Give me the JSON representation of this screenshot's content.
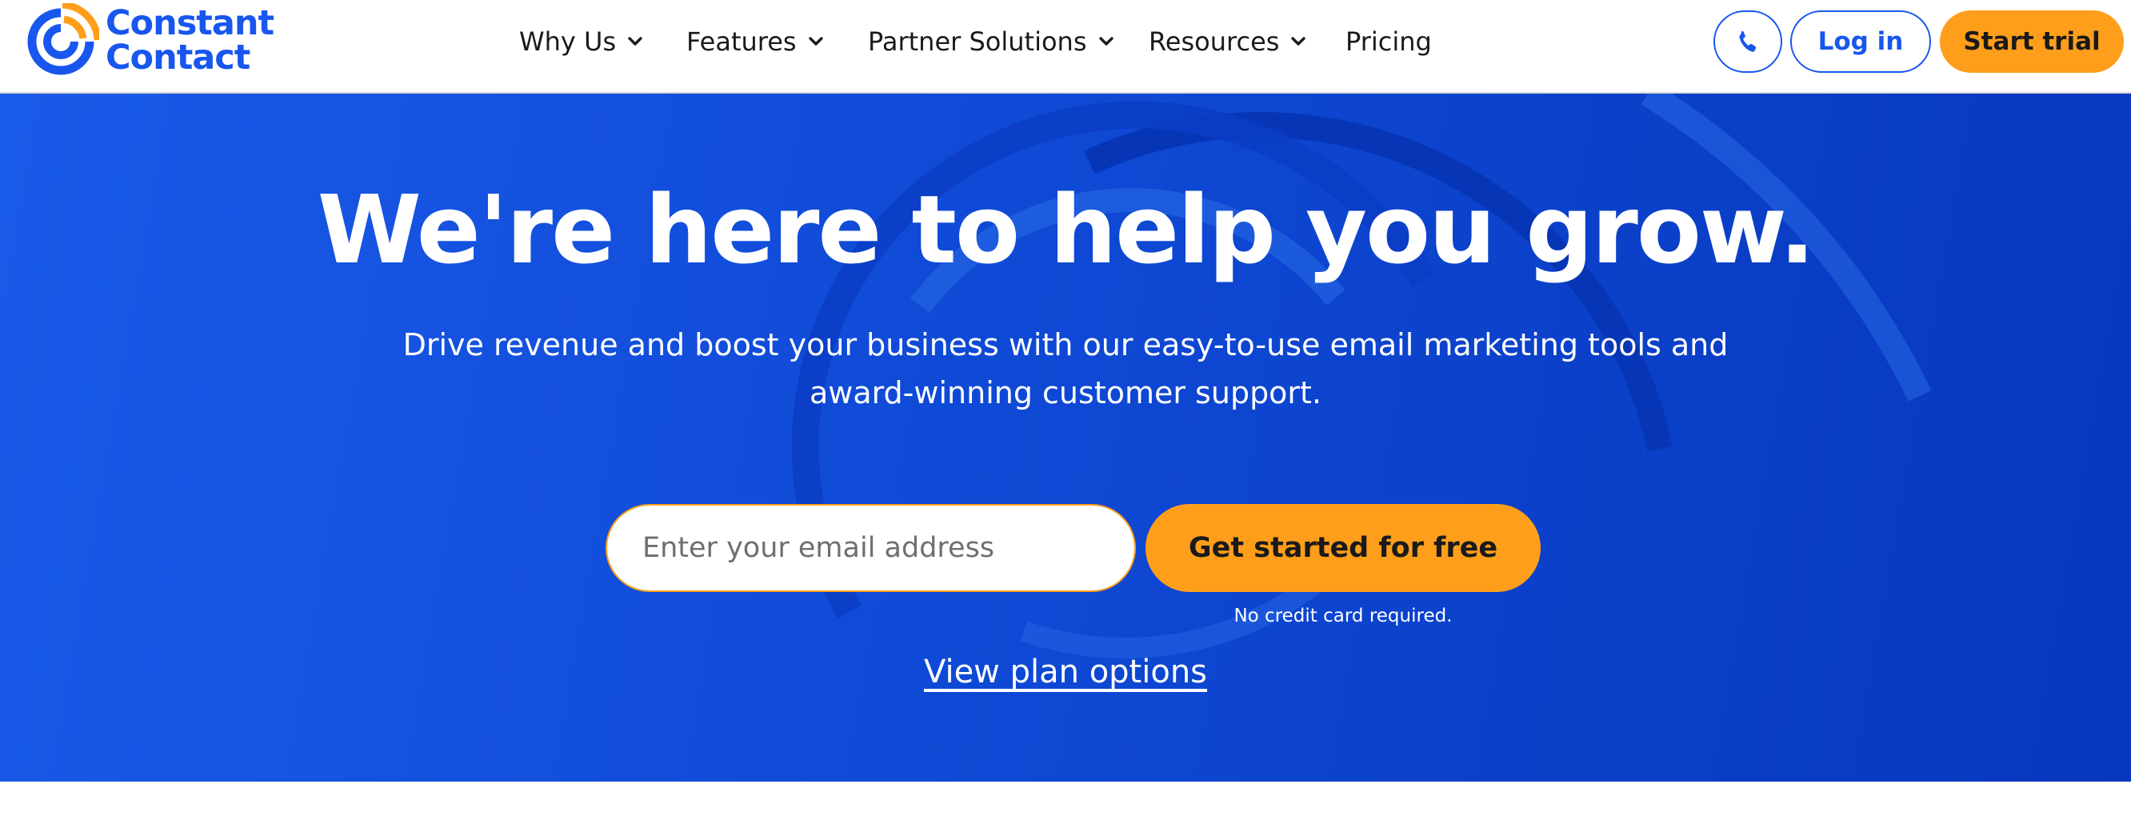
{
  "brand": {
    "name_line1": "Constant",
    "name_line2": "Contact",
    "logo_icon": "constant-contact-logo-icon"
  },
  "nav": {
    "items": [
      {
        "label": "Why Us",
        "has_dropdown": true
      },
      {
        "label": "Features",
        "has_dropdown": true
      },
      {
        "label": "Partner Solutions",
        "has_dropdown": true
      },
      {
        "label": "Resources",
        "has_dropdown": true
      },
      {
        "label": "Pricing",
        "has_dropdown": false
      }
    ],
    "dropdown_icon": "chevron-down-icon"
  },
  "header_actions": {
    "phone_icon": "phone-icon",
    "login_label": "Log in",
    "trial_label": "Start trial"
  },
  "hero": {
    "headline": "We're here to help you grow.",
    "subcopy": "Drive revenue and boost your business with our easy-to-use email marketing tools and award-winning customer support.",
    "email_placeholder": "Enter your email address",
    "email_value": "",
    "cta_label": "Get started for free",
    "fine_print": "No credit card required.",
    "plan_link": "View plan options"
  },
  "colors": {
    "brand_blue": "#1856ed",
    "accent_orange": "#ff9e1b",
    "hero_blue_dark": "#0737bd",
    "text_dark": "#1a1a1a"
  }
}
